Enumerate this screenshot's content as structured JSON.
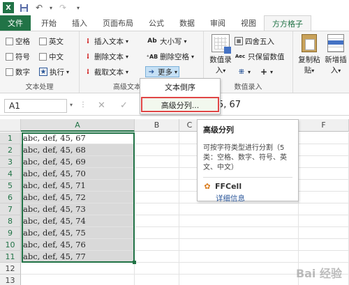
{
  "titlebar": {
    "app_icon": "X"
  },
  "tabs": [
    "文件",
    "开始",
    "插入",
    "页面布局",
    "公式",
    "数据",
    "审阅",
    "视图",
    "方方格子"
  ],
  "ribbon": {
    "group1": {
      "label": "文本处理",
      "items": [
        "空格",
        "英文",
        "符号",
        "中文",
        "数字"
      ],
      "exec": "执行"
    },
    "group2": {
      "label": "高级文本",
      "items": [
        "插入文本",
        "删除文本",
        "截取文本"
      ],
      "case": "大小写",
      "del_space": "删除空格",
      "more": "更多"
    },
    "group3": {
      "label": "数值录入",
      "round": "四舍五入",
      "keep_value": "只保留数值",
      "record": "数值录",
      "record2": "入"
    },
    "group4": {
      "copy": "复制粘",
      "copy2": "贴",
      "add": "新增插",
      "add2": "入"
    }
  },
  "namebox": "A1",
  "formula": "5, 67",
  "columns": [
    "A",
    "B",
    "C",
    "F"
  ],
  "rows": [
    "1",
    "2",
    "3",
    "4",
    "5",
    "6",
    "7",
    "8",
    "9",
    "10",
    "11",
    "12",
    "13"
  ],
  "cells": [
    "abc, def, 45, 67",
    "abc, def, 45, 68",
    "abc, def, 45, 69",
    "abc, def, 45, 70",
    "abc, def, 45, 71",
    "abc, def, 45, 72",
    "abc, def, 45, 73",
    "abc, def, 45, 74",
    "abc, def, 45, 75",
    "abc, def, 45, 76",
    "abc, def, 45, 77"
  ],
  "menu": {
    "item1": "文本倒序",
    "item2": "高级分列..."
  },
  "tooltip": {
    "title": "高级分列",
    "desc": "可按字符类型进行分割（5类：空格、数字、符号、英文、中文）",
    "brand": "FFCell",
    "link": "详细信息"
  },
  "watermark": "Bai 经验",
  "colors": {
    "excel_green": "#217346",
    "selection_gray": "#d9d9d9",
    "highlight_red": "#e04646"
  }
}
